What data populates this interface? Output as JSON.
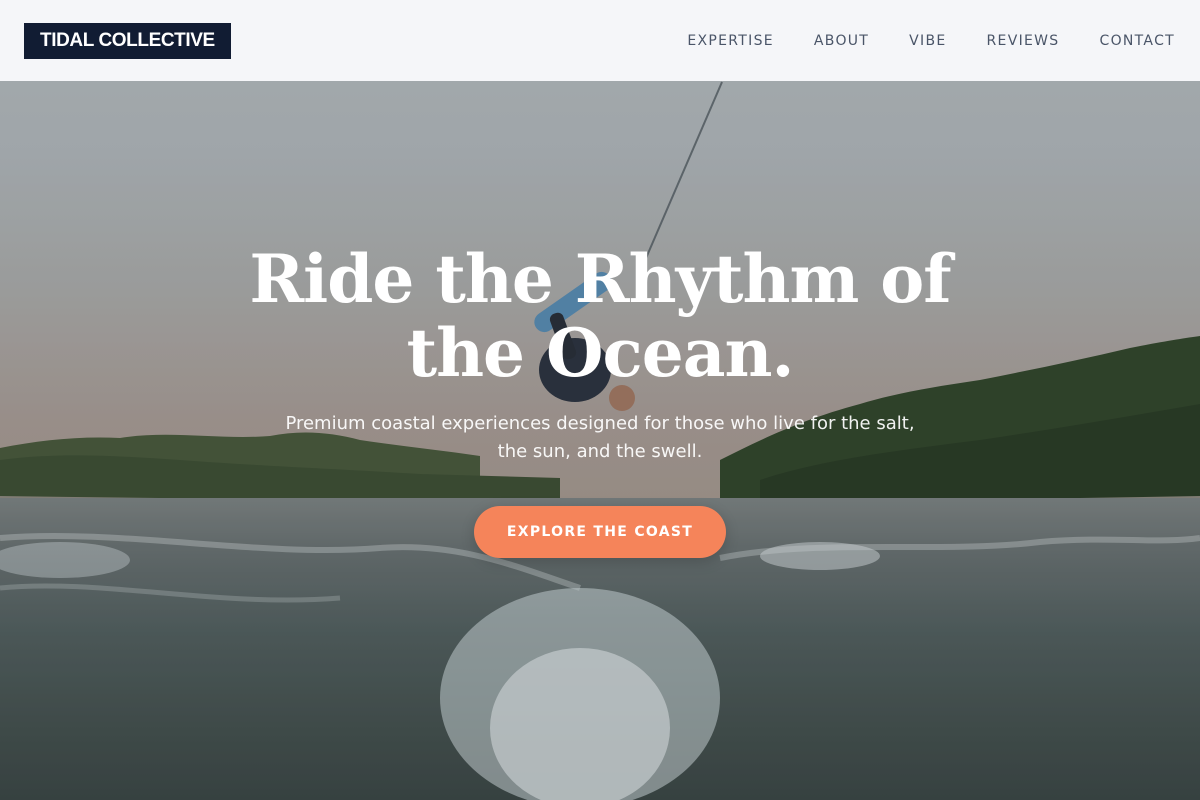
{
  "header": {
    "logo": "TIDAL COLLECTIVE",
    "nav": [
      {
        "label": "EXPERTISE"
      },
      {
        "label": "ABOUT"
      },
      {
        "label": "VIBE"
      },
      {
        "label": "REVIEWS"
      },
      {
        "label": "CONTACT"
      }
    ]
  },
  "hero": {
    "title": "Ride the Rhythm of the Ocean.",
    "subtitle": "Premium coastal experiences designed for those who live for the salt, the sun, and the swell.",
    "cta_label": "EXPLORE THE COAST",
    "image_subject": "wakeboarder-flipping-over-lake-wake"
  },
  "colors": {
    "logo_bg": "#111c33",
    "cta": "#f5845a",
    "nav_text": "#4a5568",
    "header_bg": "#f8f9fb"
  }
}
